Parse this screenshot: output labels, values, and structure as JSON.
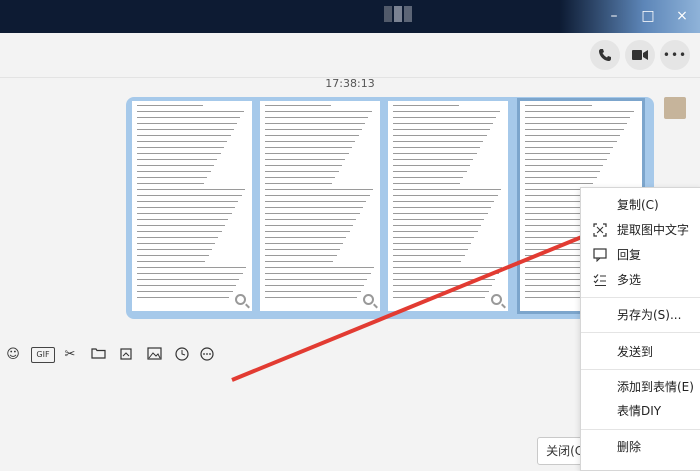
{
  "chat": {
    "timestamp": "17:38:13"
  },
  "context_menu": {
    "items": [
      {
        "label": "复制(C)"
      },
      {
        "label": "提取图中文字"
      },
      {
        "label": "回复"
      },
      {
        "label": "多选"
      },
      {
        "label": "另存为(S)..."
      },
      {
        "label": "发送到"
      },
      {
        "label": "添加到表情(E)"
      },
      {
        "label": "表情DIY"
      },
      {
        "label": "删除"
      }
    ]
  },
  "compose": {
    "close_label": "关闭(C)",
    "gif_label": "GIF"
  },
  "colors": {
    "accent_arrow": "#e23b32",
    "bubble": "#a6c9ea",
    "titlebar": "#0d1b33"
  },
  "icons": [
    "phone-icon",
    "video-icon",
    "more-icon",
    "emoji-icon",
    "gif-icon",
    "scissors-icon",
    "folder-icon",
    "screenshot-icon",
    "image-icon",
    "time-icon",
    "more-dots-icon",
    "minimize-icon",
    "maximize-icon",
    "close-icon"
  ]
}
